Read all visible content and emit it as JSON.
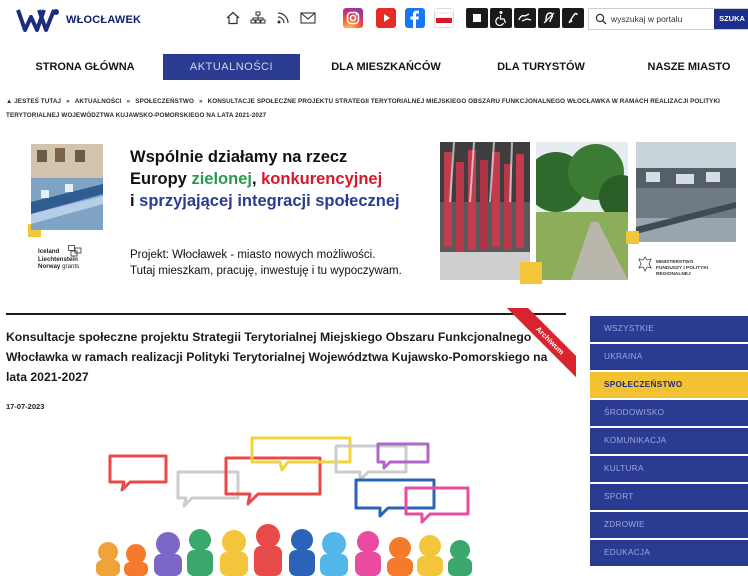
{
  "header": {
    "logo_text": "WŁOCŁAWEK",
    "utility_icons": [
      "home-icon",
      "sitemap-icon",
      "rss-icon",
      "mail-icon"
    ],
    "social_icons": [
      "instagram-icon",
      "youtube-icon",
      "facebook-icon",
      "flag-icon"
    ],
    "accessibility_icons": [
      "contrast-icon",
      "wheelchair-icon",
      "sign-language-icon",
      "deaf-icon",
      "mute-icon"
    ],
    "search": {
      "placeholder": "wyszukaj w portalu",
      "button": "SZUKA"
    }
  },
  "nav": {
    "items": [
      {
        "label": "STRONA GŁÓWNA"
      },
      {
        "label": "AKTUALNOŚCI"
      },
      {
        "label": "DLA MIESZKAŃCÓW"
      },
      {
        "label": "DLA TURYSTÓW"
      },
      {
        "label": "NASZE MIASTO"
      }
    ],
    "active": "AKTUALNOŚCI"
  },
  "breadcrumb": {
    "items": [
      "JESTEŚ TUTAJ",
      "AKTUALNOŚCI",
      "SPOŁECZEŃSTWO",
      "KONSULTACJE SPOŁECZNE PROJEKTU STRATEGII TERYTORIALNEJ MIEJSKIEGO OBSZARU FUNKCJONALNEGO WŁOCŁAWKA W RAMACH REALIZACJI POLITYKI TERYTORIALNEJ WOJEWÓDZTWA KUJAWSKO-POMORSKIEGO NA LATA 2021-2027"
    ]
  },
  "banner": {
    "heading_line1": "Wspólnie działamy na rzecz",
    "heading_line2_a": "Europy ",
    "heading_line2_green": "zielonej",
    "heading_line2_b": ", ",
    "heading_line2_red": "konkurencyjnej",
    "heading_line3_a": "i ",
    "heading_line3_blue": "sprzyjającej integracji społecznej",
    "project_line1": "Projekt: Włocławek - miasto nowych możliwości.",
    "project_line2": "Tutaj mieszkam, pracuję, inwestuję i tu wypoczywam.",
    "eea_line1": "Iceland",
    "eea_line2": "Liechtenstein",
    "eea_line3a": "Norway",
    "eea_line3b": " grants",
    "ministry_line1": "MINISTERSTWO",
    "ministry_line2": "FUNDUSZY I POLITYKI",
    "ministry_line3": "REGIONALNEJ"
  },
  "article": {
    "title": "Konsultacje społeczne projektu Strategii Terytorialnej Miejskiego Obszaru Funkcjonalnego Włocławka w ramach realizacji Polityki Terytorialnej Województwa Kujawsko-Pomorskiego na lata 2021-2027",
    "date": "17-07-2023",
    "ribbon": "Archiwum"
  },
  "categories": {
    "items": [
      "WSZYSTKIE",
      "UKRAINA",
      "SPOŁECZEŃSTWO",
      "ŚRODOWISKO",
      "KOMUNIKACJA",
      "KULTURA",
      "SPORT",
      "ZDROWIE",
      "EDUKACJA"
    ],
    "active": "SPOŁECZEŃSTWO"
  },
  "colors": {
    "nav_blue": "#2a3b91",
    "accent_yellow": "#f3c233",
    "ribbon_red": "#d9232e",
    "green": "#2a9a4c",
    "red": "#d6182a"
  }
}
